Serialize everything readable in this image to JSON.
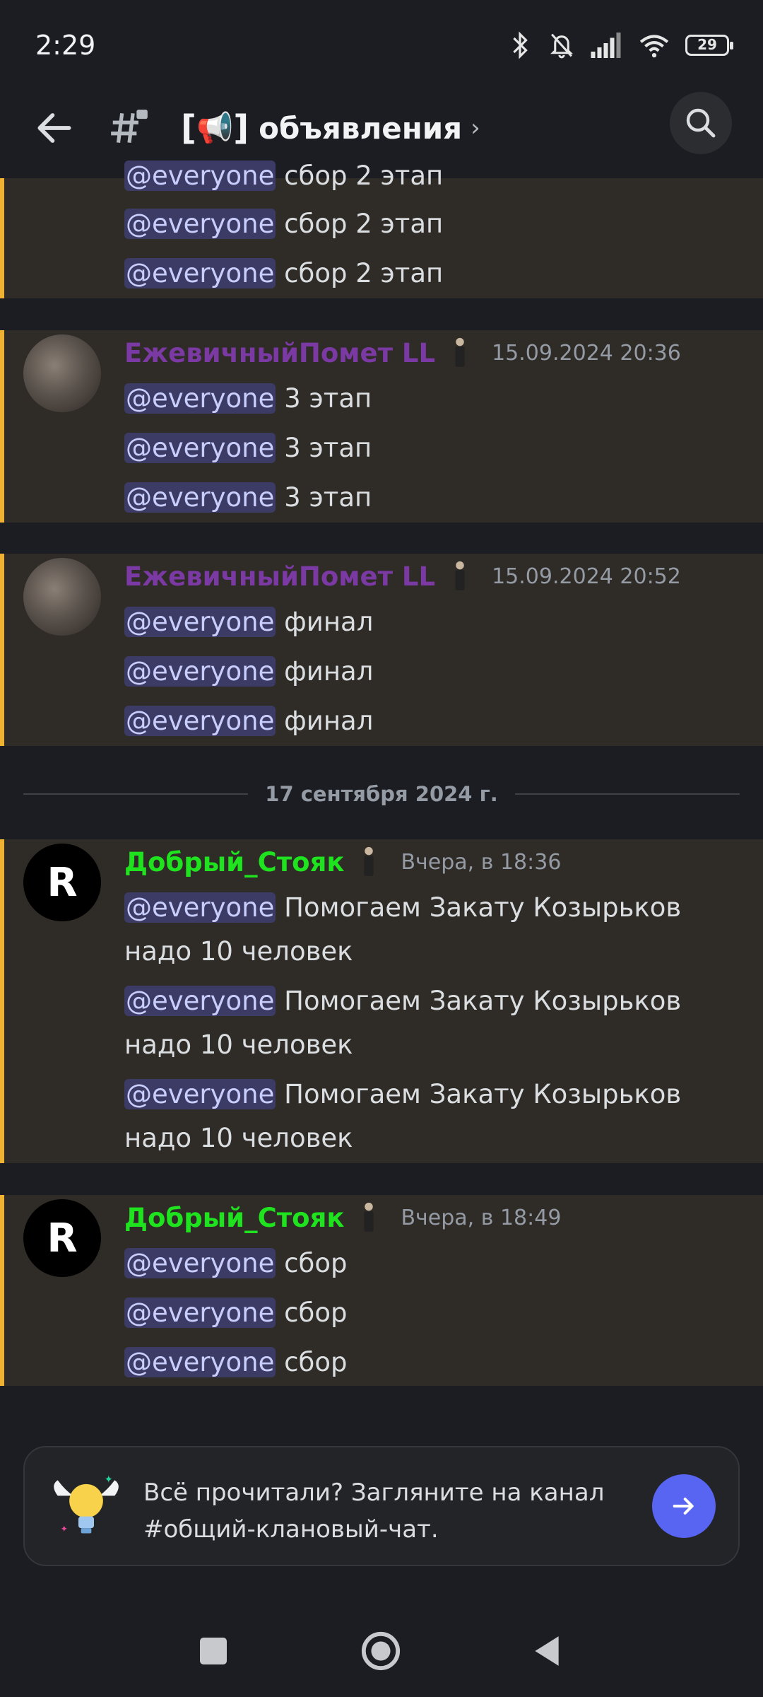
{
  "status_bar": {
    "time": "2:29",
    "battery": "29"
  },
  "header": {
    "channel_icon": "📢",
    "channel_name": "объявления",
    "chevron": "›"
  },
  "messages": [
    {
      "lines": [
        {
          "mention": "@everyone",
          "text": " сбор 2 этап"
        },
        {
          "mention": "@everyone",
          "text": " сбор 2 этап"
        },
        {
          "mention": "@everyone",
          "text": " сбор 2 этап"
        }
      ]
    },
    {
      "author": "ЕжевичныйПомет LL",
      "timestamp": "15.09.2024 20:36",
      "lines": [
        {
          "mention": "@everyone",
          "text": " 3 этап"
        },
        {
          "mention": "@everyone",
          "text": " 3 этап"
        },
        {
          "mention": "@everyone",
          "text": " 3 этап"
        }
      ]
    },
    {
      "author": "ЕжевичныйПомет LL",
      "timestamp": "15.09.2024 20:52",
      "lines": [
        {
          "mention": "@everyone",
          "text": " финал"
        },
        {
          "mention": "@everyone",
          "text": " финал"
        },
        {
          "mention": "@everyone",
          "text": " финал"
        }
      ]
    },
    {
      "author": "Добрый_Стояк",
      "timestamp": "Вчера, в 18:36",
      "avatar_letter": "R",
      "lines": [
        {
          "mention": "@everyone",
          "text": " Помогаем Закату Козырьков",
          "cont": "надо 10 человек"
        },
        {
          "mention": "@everyone",
          "text": " Помогаем Закату Козырьков",
          "cont": "надо 10 человек"
        },
        {
          "mention": "@everyone",
          "text": " Помогаем Закату Козырьков",
          "cont": "надо 10 человек"
        }
      ]
    },
    {
      "author": "Добрый_Стояк",
      "timestamp": "Вчера, в 18:49",
      "avatar_letter": "R",
      "lines": [
        {
          "mention": "@everyone",
          "text": " сбор"
        },
        {
          "mention": "@everyone",
          "text": " сбор"
        },
        {
          "mention": "@everyone",
          "text": " сбор"
        }
      ]
    }
  ],
  "date_divider": "17 сентября 2024 г.",
  "next_channel": {
    "line1": "Всё прочитали? Загляните на канал",
    "line2": "#общий-клановый-чат."
  },
  "colors": {
    "accent": "#5865f2",
    "highlight_bar": "#f0b232",
    "author_purple": "#7b3aa3",
    "author_green": "#1ee31e"
  }
}
